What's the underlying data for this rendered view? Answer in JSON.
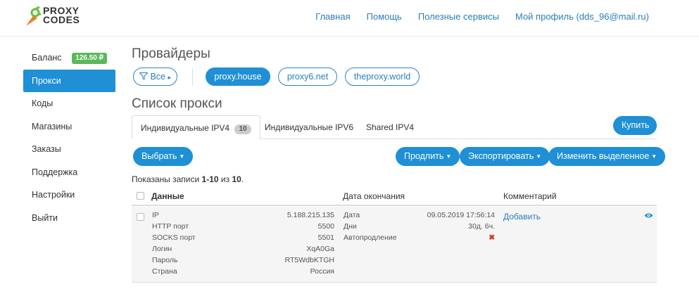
{
  "brand": {
    "line1": "PROXY",
    "line2": "CODES"
  },
  "nav": [
    {
      "label": "Главная"
    },
    {
      "label": "Помощь"
    },
    {
      "label": "Полезные сервисы"
    },
    {
      "label": "Мой профиль (dds_96@mail.ru)"
    }
  ],
  "sidebar": {
    "balance": {
      "label": "Баланс",
      "value": "126.50 ₽"
    },
    "items": [
      {
        "label": "Прокси",
        "active": true
      },
      {
        "label": "Коды"
      },
      {
        "label": "Магазины"
      },
      {
        "label": "Заказы"
      },
      {
        "label": "Поддержка"
      },
      {
        "label": "Настройки"
      },
      {
        "label": "Выйти"
      }
    ]
  },
  "providers": {
    "title": "Провайдеры",
    "filter_label": "Все",
    "items": [
      "proxy.house",
      "proxy6.net",
      "theproxy.world"
    ],
    "active": "proxy.house"
  },
  "proxy_list": {
    "title": "Список прокси",
    "tabs": [
      {
        "label": "Индивидуальные IPV4",
        "count": "10"
      },
      {
        "label": "Индивидуальные IPV6"
      },
      {
        "label": "Shared IPV4"
      }
    ],
    "buy_label": "Купить",
    "select_label": "Выбрать",
    "extend_label": "Продлить",
    "export_label": "Экспортировать",
    "edit_label": "Изменить выделенное",
    "info": {
      "prefix": "Показаны записи ",
      "range": "1-10",
      "mid": " из ",
      "total": "10",
      "suffix": "."
    },
    "columns": {
      "data": "Данные",
      "end_date": "Дата окончания",
      "comment": "Комментарий"
    },
    "row": {
      "data": [
        {
          "k": "IP",
          "v": "5.188.215.135"
        },
        {
          "k": "HTTP порт",
          "v": "5500"
        },
        {
          "k": "SOCKS порт",
          "v": "5501"
        },
        {
          "k": "Логин",
          "v": "XqA0Ga"
        },
        {
          "k": "Пароль",
          "v": "RT5WdbKTGH"
        },
        {
          "k": "Страна",
          "v": "Россия"
        }
      ],
      "end": [
        {
          "k": "Дата",
          "v": "09.05.2019 17:56:14"
        },
        {
          "k": "Дни",
          "v": "30д. 6ч."
        },
        {
          "k": "Автопродление",
          "v": "✖"
        }
      ],
      "comment_link": "Добавить"
    }
  },
  "colors": {
    "primary": "#1f8fd6",
    "link": "#2a7fb8",
    "success": "#5cb85c",
    "danger": "#d0342c"
  }
}
